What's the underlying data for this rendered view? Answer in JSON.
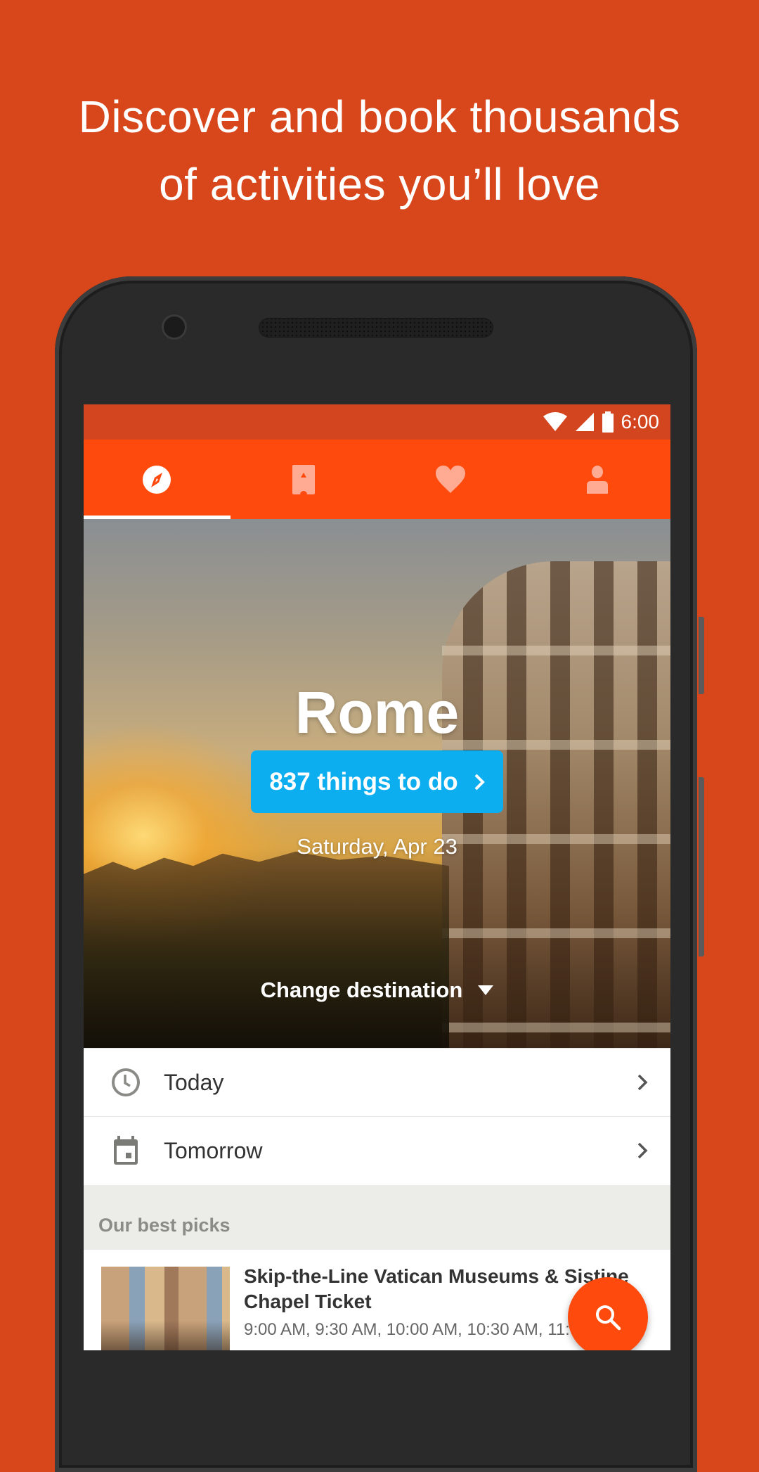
{
  "promo": {
    "headline_line1": "Discover and book thousands",
    "headline_line2": "of activities you’ll love"
  },
  "status_bar": {
    "time": "6:00",
    "icons": [
      "wifi-icon",
      "cellular-signal-icon",
      "battery-icon"
    ]
  },
  "tabs": [
    {
      "name": "explore",
      "icon": "compass-icon",
      "active": true
    },
    {
      "name": "bookings",
      "icon": "ticket-icon",
      "active": false
    },
    {
      "name": "wishlist",
      "icon": "heart-icon",
      "active": false
    },
    {
      "name": "profile",
      "icon": "person-icon",
      "active": false
    }
  ],
  "hero": {
    "city": "Rome",
    "things_to_do_label": "837 things to do",
    "date": "Saturday, Apr 23",
    "change_destination_label": "Change destination"
  },
  "date_options": [
    {
      "label": "Today",
      "icon": "clock-icon"
    },
    {
      "label": "Tomorrow",
      "icon": "calendar-icon"
    }
  ],
  "best_picks": {
    "title": "Our best picks",
    "items": [
      {
        "title": "Skip-the-Line Vatican Museums & Sistine Chapel Ticket",
        "times": "9:00 AM, 9:30 AM, 10:00 AM, 10:30 AM, 11:00 AM"
      }
    ]
  },
  "fab": {
    "icon": "search-icon"
  },
  "colors": {
    "background": "#D8461B",
    "status_bar": "#D2451F",
    "tab_bar": "#FF4A0E",
    "cta_button": "#0DAEF0",
    "section_bg": "#ECECE8",
    "fab": "#FF4A0E"
  }
}
